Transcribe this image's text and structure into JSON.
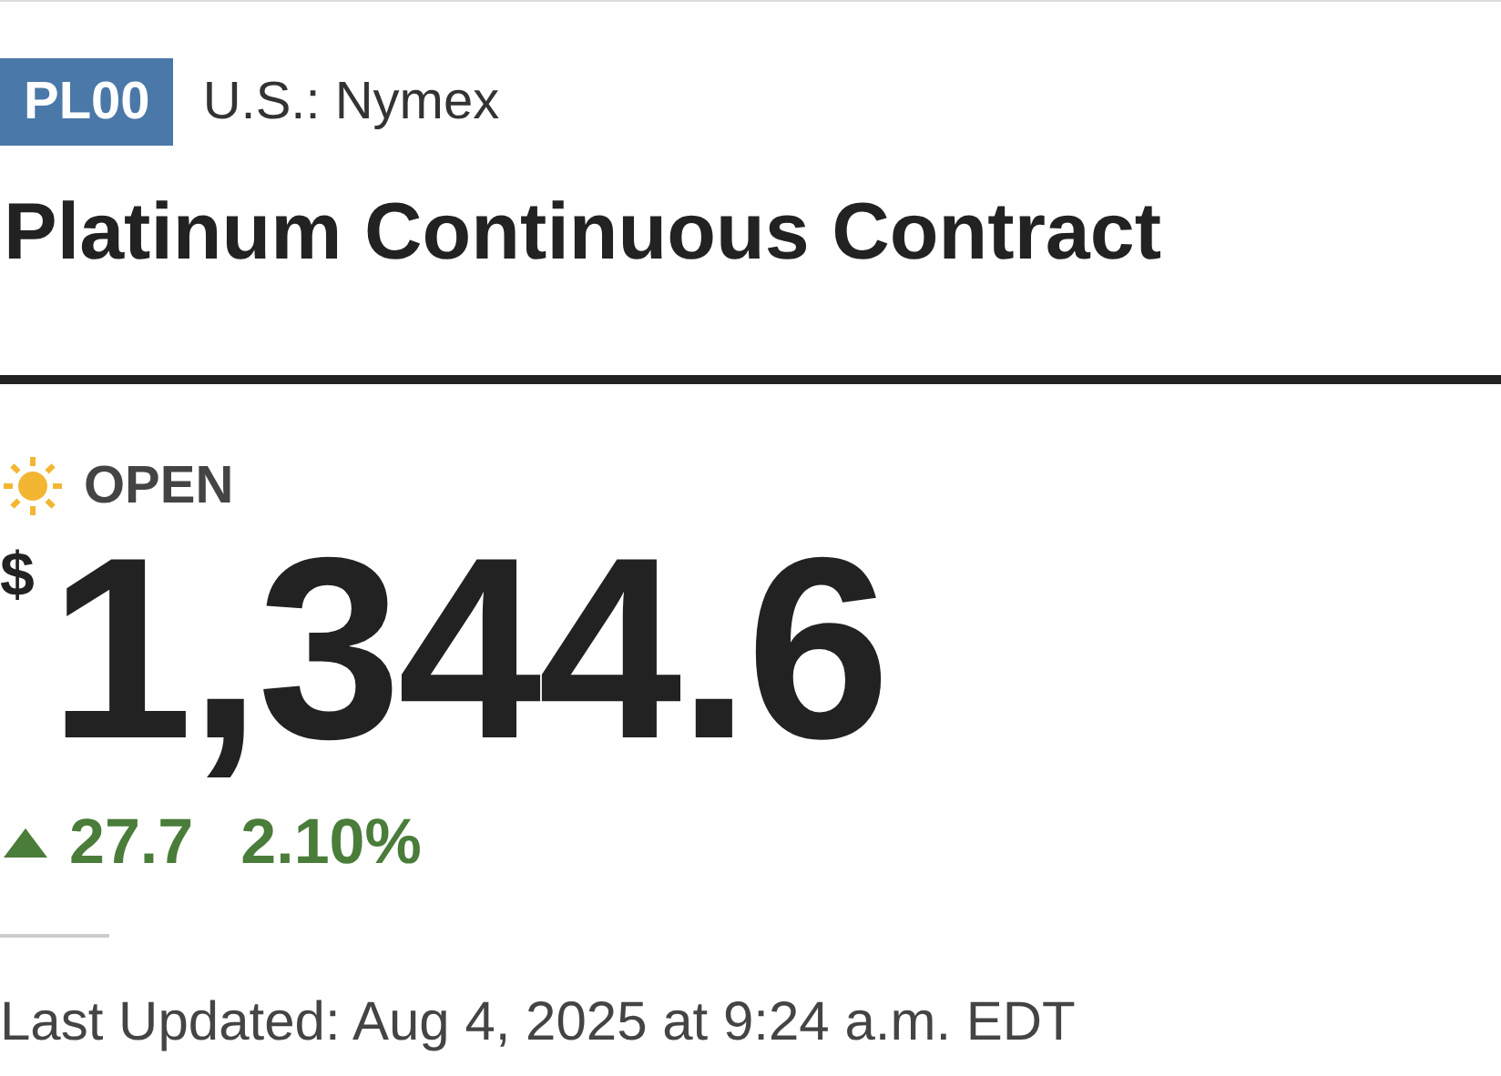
{
  "symbol": "PL00",
  "exchange": "U.S.: Nymex",
  "title": "Platinum Continuous Contract",
  "market_status": {
    "kind": "open",
    "label": "OPEN"
  },
  "price": {
    "currency": "$",
    "value": "1,344.6"
  },
  "change": {
    "rising": true,
    "amount": "27.7",
    "percent": "2.10%"
  },
  "last_updated": "Last Updated: Aug 4, 2025 at 9:24 a.m. EDT"
}
